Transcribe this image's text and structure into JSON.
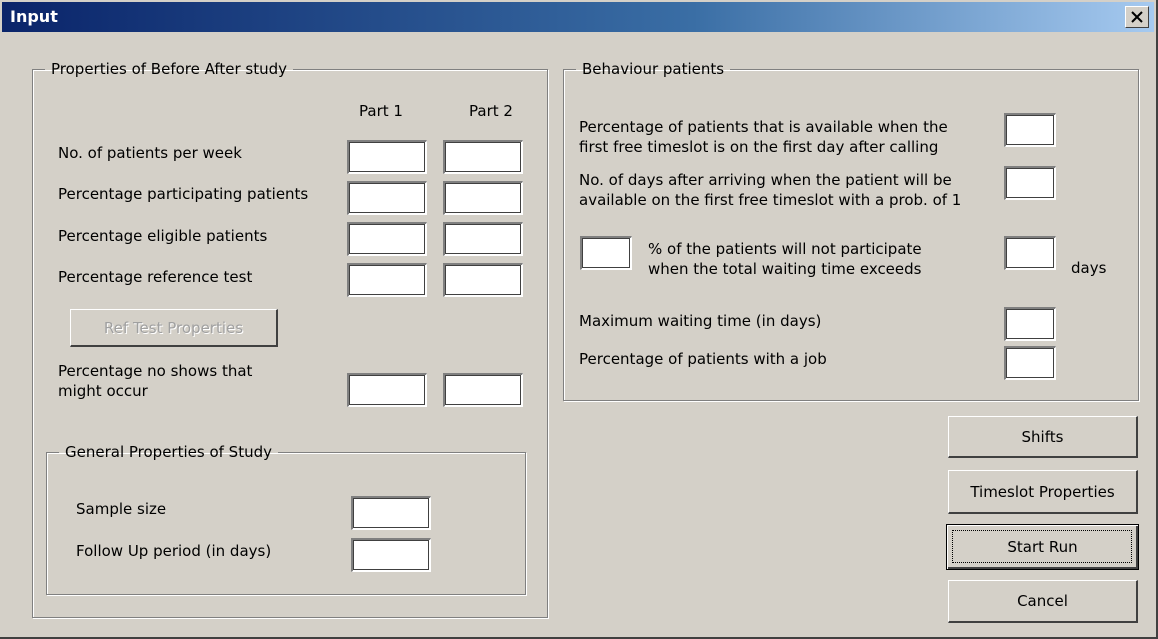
{
  "window": {
    "title": "Input"
  },
  "before_after": {
    "legend": "Properties of Before After study",
    "col_part1": "Part 1",
    "col_part2": "Part 2",
    "rows": [
      {
        "label": "No. of patients per week",
        "part1": "",
        "part2": ""
      },
      {
        "label": "Percentage participating patients",
        "part1": "",
        "part2": ""
      },
      {
        "label": "Percentage eligible patients",
        "part1": "",
        "part2": ""
      },
      {
        "label": "Percentage reference test",
        "part1": "",
        "part2": ""
      }
    ],
    "ref_test_button": "Ref Test Properties",
    "no_shows_label_1": "Percentage no shows that",
    "no_shows_label_2": "might occur",
    "no_shows_part1": "",
    "no_shows_part2": ""
  },
  "general": {
    "legend": "General Properties of Study",
    "sample_size_label": "Sample size",
    "sample_size": "",
    "follow_up_label": "Follow Up period (in days)",
    "follow_up": ""
  },
  "behaviour": {
    "legend": "Behaviour patients",
    "available_label_1": "Percentage of patients that is available when the",
    "available_label_2": "first free timeslot is on the first day after calling",
    "available_value": "",
    "days_after_label_1": "No. of days after arriving when the patient will be",
    "days_after_label_2": "available on the first free timeslot with a prob. of 1",
    "days_after_value": "",
    "not_participate_pct": "",
    "not_participate_label_1": "% of the patients will not participate",
    "not_participate_label_2": "when the total waiting time exceeds",
    "exceeds_days": "",
    "days_unit": "days",
    "max_wait_label": "Maximum waiting time (in days)",
    "max_wait_value": "",
    "job_label": "Percentage of patients with a job",
    "job_value": ""
  },
  "buttons": {
    "shifts": "Shifts",
    "timeslot": "Timeslot Properties",
    "start_run": "Start Run",
    "cancel": "Cancel"
  },
  "colors": {
    "dialog_face": "#d4d0c8",
    "title_start": "#0a246a",
    "title_end": "#a6caf0"
  }
}
